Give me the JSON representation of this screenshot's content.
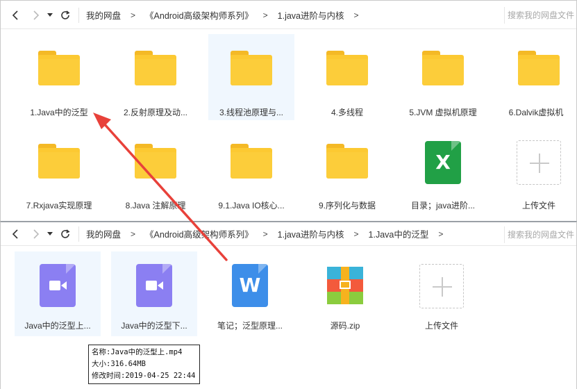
{
  "top": {
    "crumbs": [
      "我的网盘",
      "《Android高级架构师系列》",
      "1.java进阶与内核"
    ],
    "search_placeholder": "搜索我的网盘文件",
    "items": [
      {
        "label": "1.Java中的泛型",
        "icon": "folder-icon"
      },
      {
        "label": "2.反射原理及动...",
        "icon": "folder-icon"
      },
      {
        "label": "3.线程池原理与...",
        "icon": "folder-icon"
      },
      {
        "label": "4.多线程",
        "icon": "folder-icon"
      },
      {
        "label": "5.JVM 虚拟机原理",
        "icon": "folder-icon"
      },
      {
        "label": "6.Dalvik虚拟机",
        "icon": "folder-icon"
      },
      {
        "label": "7.Rxjava实现原理",
        "icon": "folder-icon"
      },
      {
        "label": "8.Java 注解原理",
        "icon": "folder-icon"
      },
      {
        "label": "9.1.Java IO核心...",
        "icon": "folder-icon"
      },
      {
        "label": "9.序列化与数据",
        "icon": "folder-icon"
      },
      {
        "label": "目录；java进阶...",
        "icon": "excel-icon",
        "glyph": "X"
      },
      {
        "label": "上传文件",
        "icon": "upload-plus-icon"
      }
    ]
  },
  "bottom": {
    "crumbs": [
      "我的网盘",
      "《Android高级架构师系列》",
      "1.java进阶与内核",
      "1.Java中的泛型"
    ],
    "search_placeholder": "搜索我的网盘文件",
    "items": [
      {
        "label": "Java中的泛型上...",
        "icon": "video-icon"
      },
      {
        "label": "Java中的泛型下...",
        "icon": "video-icon"
      },
      {
        "label": "笔记；泛型原理...",
        "icon": "word-icon",
        "glyph": "W"
      },
      {
        "label": "源码.zip",
        "icon": "zip-archive-icon"
      },
      {
        "label": "上传文件",
        "icon": "upload-plus-icon"
      }
    ]
  },
  "tooltip": {
    "name": "名称:Java中的泛型上.mp4",
    "size": "大小:316.64MB",
    "modified": "修改时间:2019-04-25 22:44"
  },
  "colors": {
    "folder": "#fcc932",
    "excel": "#21a046",
    "word": "#3d8ee9",
    "video": "#8b7ff2",
    "annotation_arrow": "#e8413a",
    "selected_tile": "#f0f7fe"
  }
}
